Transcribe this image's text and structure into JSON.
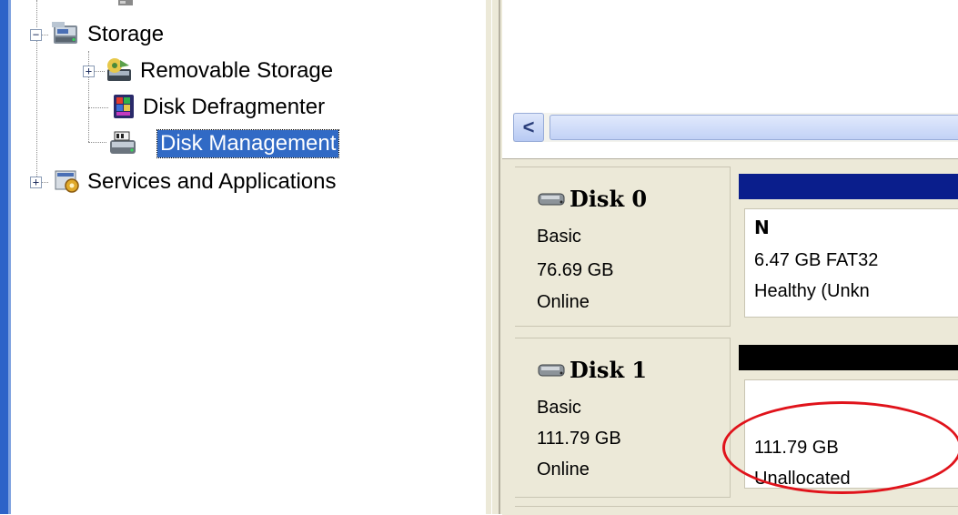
{
  "tree": {
    "items": [
      {
        "label": "Storage",
        "icon": "storage-icon",
        "expander": "−"
      },
      {
        "label": "Removable Storage",
        "icon": "removable-storage-icon",
        "expander": "+"
      },
      {
        "label": "Disk Defragmenter",
        "icon": "disk-defragmenter-icon"
      },
      {
        "label": "Disk Management",
        "icon": "disk-management-icon",
        "selected": true
      },
      {
        "label": "Services and Applications",
        "icon": "services-applications-icon",
        "expander": "+"
      }
    ]
  },
  "scrollbar": {
    "left_arrow": "<"
  },
  "disks": [
    {
      "name": "Disk 0",
      "type": "Basic",
      "size": "76.69 GB",
      "status": "Online",
      "bar_color": "#0a1e8c",
      "partition": {
        "letter": "N",
        "detail": "6.47 GB FAT32",
        "health": "Healthy (Unkn"
      }
    },
    {
      "name": "Disk 1",
      "type": "Basic",
      "size": "111.79 GB",
      "status": "Online",
      "bar_color": "#000000",
      "partition": {
        "size": "111.79 GB",
        "state": "Unallocated"
      }
    }
  ],
  "colors": {
    "selection": "#316ac5",
    "highlight_ellipse": "#e0131b",
    "window_accent": "#2d63c8"
  }
}
